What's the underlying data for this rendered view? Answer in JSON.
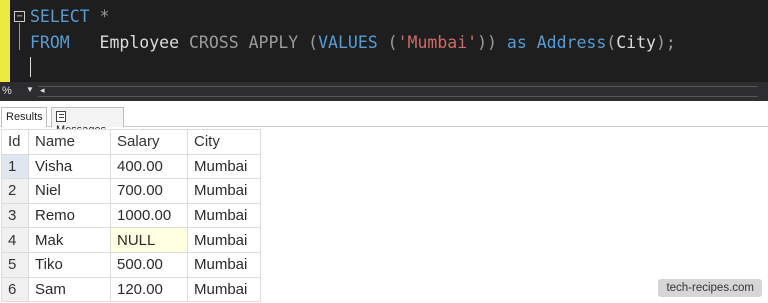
{
  "editor": {
    "line1": {
      "select": "SELECT",
      "star": " *"
    },
    "line2": {
      "from": "FROM",
      "table": "   Employee ",
      "cross_apply": "CROSS APPLY",
      "open_paren": " (",
      "values": "VALUES",
      "space_paren": " (",
      "string": "'Mumbai'",
      "close": ")) ",
      "as": "as",
      "space": " ",
      "alias": "Address",
      "alias_open": "(",
      "column": "City",
      "alias_close": ");"
    },
    "fold_symbol": "−",
    "colors": {
      "keyword": "#569cd6",
      "string": "#d16969",
      "text": "#dcdcdc",
      "background": "#1e1e1e",
      "gutter": "#e9ec3f"
    }
  },
  "statusbar": {
    "zoom": "%",
    "zoom_arrow": "▼",
    "scroll_left": "◂"
  },
  "tabs": [
    {
      "label": "Results"
    },
    {
      "label": "Messages",
      "icon": "messages-icon"
    }
  ],
  "grid": {
    "columns": [
      "Id",
      "Name",
      "Salary",
      "City"
    ],
    "rows": [
      {
        "id": "1",
        "name": "Visha",
        "salary": "400.00",
        "city": "Mumbai"
      },
      {
        "id": "2",
        "name": "Niel",
        "salary": "700.00",
        "city": "Mumbai"
      },
      {
        "id": "3",
        "name": "Remo",
        "salary": "1000.00",
        "city": "Mumbai"
      },
      {
        "id": "4",
        "name": "Mak",
        "salary": "NULL",
        "city": "Mumbai"
      },
      {
        "id": "5",
        "name": "Tiko",
        "salary": "500.00",
        "city": "Mumbai"
      },
      {
        "id": "6",
        "name": "Sam",
        "salary": "120.00",
        "city": "Mumbai"
      }
    ]
  },
  "watermark": "tech-recipes.com"
}
